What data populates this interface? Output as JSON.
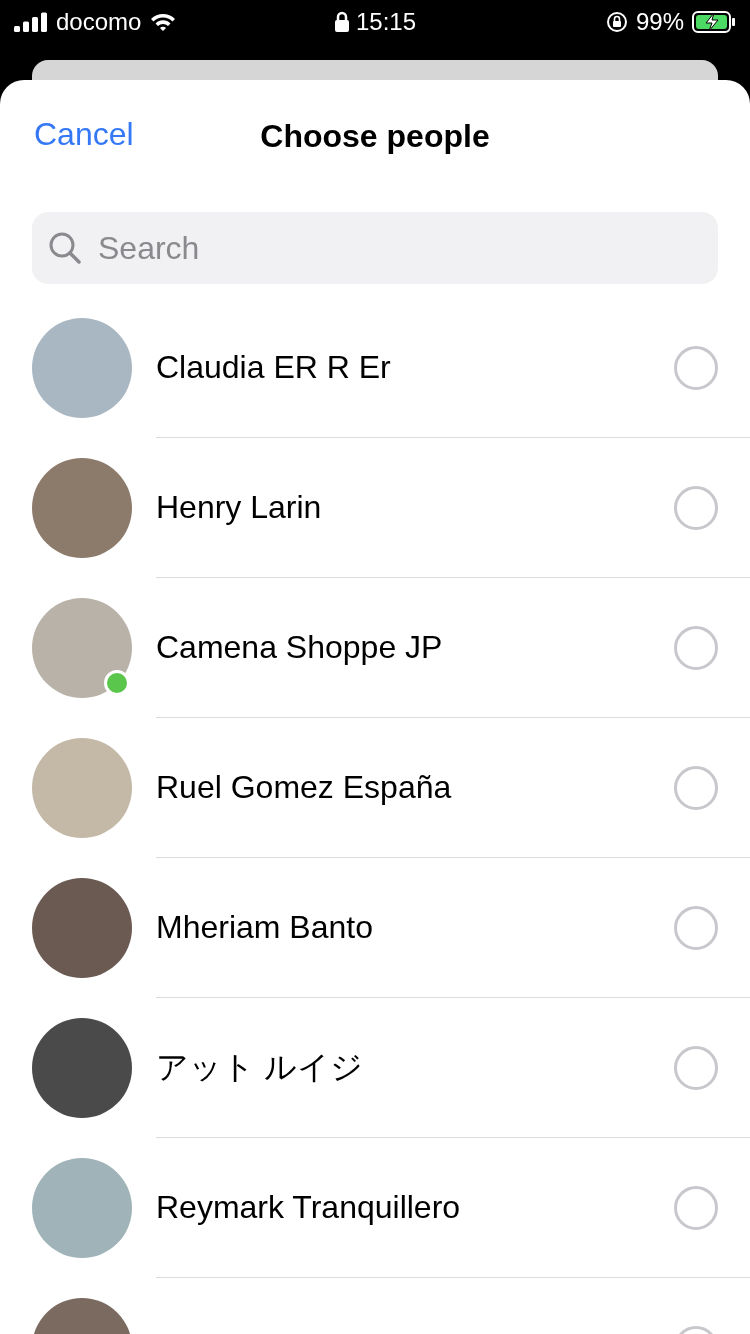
{
  "status_bar": {
    "carrier": "docomo",
    "time": "15:15",
    "battery": "99%",
    "charging": true
  },
  "header": {
    "cancel": "Cancel",
    "title": "Choose people"
  },
  "search": {
    "placeholder": "Search"
  },
  "people": [
    {
      "name": "Claudia ER R Er",
      "online": false,
      "selected": false
    },
    {
      "name": "Henry Larin",
      "online": false,
      "selected": false
    },
    {
      "name": "Camena Shoppe JP",
      "online": true,
      "selected": false
    },
    {
      "name": "Ruel Gomez España",
      "online": false,
      "selected": false
    },
    {
      "name": "Mheriam Banto",
      "online": false,
      "selected": false
    },
    {
      "name": "アット ルイジ",
      "online": false,
      "selected": false
    },
    {
      "name": "Reymark Tranquillero",
      "online": false,
      "selected": false
    },
    {
      "online": false,
      "selected": false
    }
  ]
}
